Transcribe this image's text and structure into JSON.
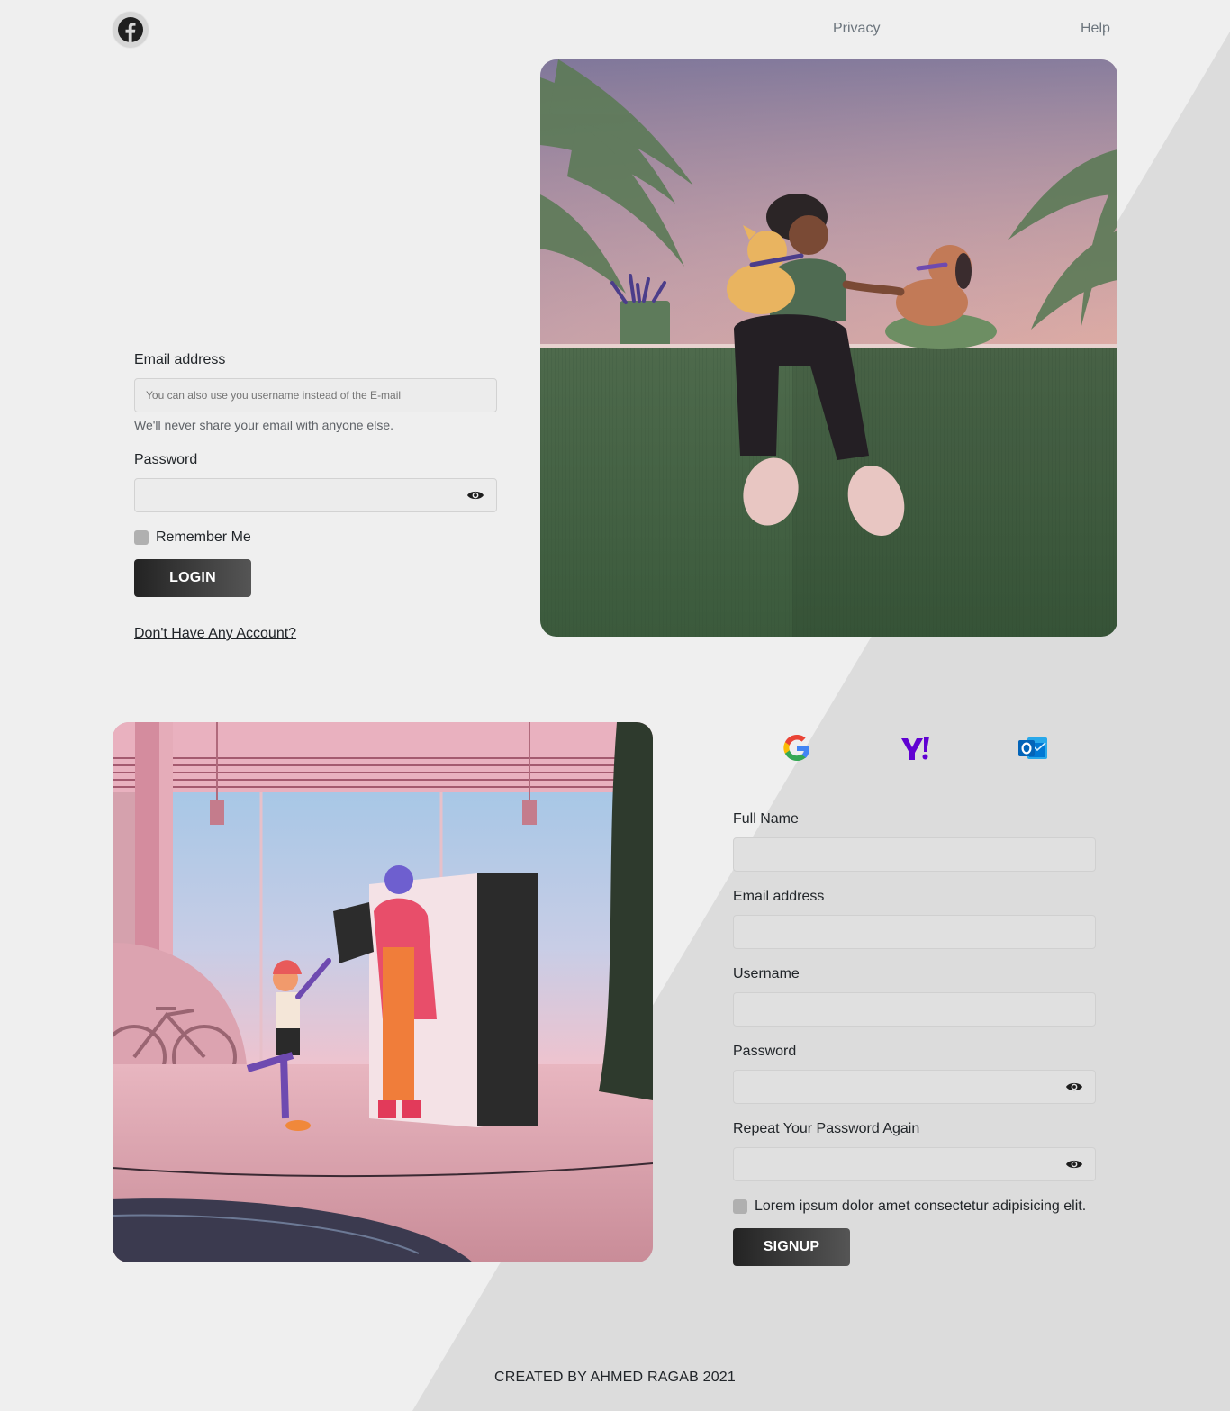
{
  "header": {
    "logo_icon": "facebook-icon",
    "nav": [
      {
        "label": "Privacy"
      },
      {
        "label": "Help"
      }
    ]
  },
  "login": {
    "email_label": "Email address",
    "email_placeholder": "You can also use you username instead of the E-mail",
    "email_hint": "We'll never share your email with anyone else.",
    "password_label": "Password",
    "remember_label": "Remember Me",
    "login_button": "LOGIN",
    "signup_link": "Don't Have Any Account?"
  },
  "signup": {
    "providers": [
      {
        "name": "google-icon"
      },
      {
        "name": "yahoo-icon"
      },
      {
        "name": "outlook-icon"
      }
    ],
    "fullname_label": "Full Name",
    "email_label": "Email address",
    "username_label": "Username",
    "password_label": "Password",
    "repeat_password_label": "Repeat Your Password Again",
    "terms_label": "Lorem ipsum dolor amet consectetur adipisicing elit.",
    "signup_button": "SIGNUP"
  },
  "footer": {
    "credit": "CREATED BY AHMED RAGAB 2021"
  },
  "colors": {
    "page_bg": "#efefef",
    "diagonal_bg": "#dcdcdc",
    "button_dark": "#232323"
  }
}
